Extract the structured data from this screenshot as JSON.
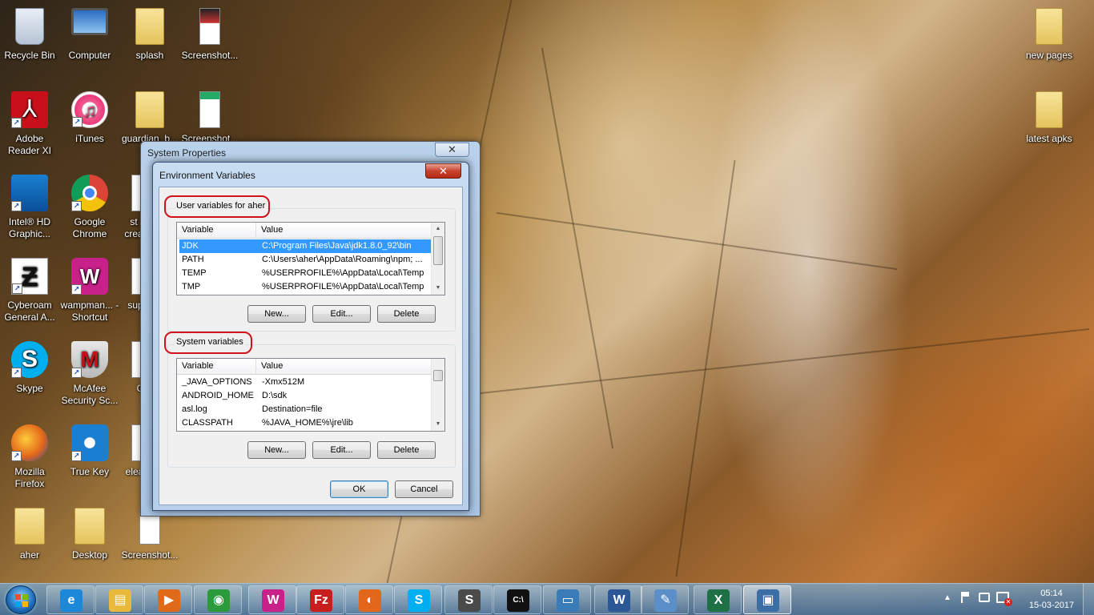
{
  "desktop": {
    "icons": [
      {
        "label": "Recycle Bin",
        "icon": "recycle-bin-icon"
      },
      {
        "label": "Computer",
        "icon": "computer-icon"
      },
      {
        "label": "splash",
        "icon": "folder-icon"
      },
      {
        "label": "Screenshot...",
        "icon": "image-file-icon"
      },
      {
        "label": "Adobe Reader XI",
        "icon": "adobe-reader-icon"
      },
      {
        "label": "iTunes",
        "icon": "itunes-icon"
      },
      {
        "label": "guardian_b...",
        "icon": "folder-icon"
      },
      {
        "label": "Screenshot...",
        "icon": "image-file-icon"
      },
      {
        "label": "Intel® HD Graphic...",
        "icon": "intel-graphics-icon"
      },
      {
        "label": "Google Chrome",
        "icon": "chrome-icon"
      },
      {
        "label": "st crea",
        "icon": "file-icon"
      },
      {
        "label": "Cyberoam General A...",
        "icon": "cyberoam-icon"
      },
      {
        "label": "wampman... - Shortcut",
        "icon": "wamp-icon"
      },
      {
        "label": "sup",
        "icon": "file-icon"
      },
      {
        "label": "Skype",
        "icon": "skype-icon"
      },
      {
        "label": "McAfee Security Sc...",
        "icon": "mcafee-icon"
      },
      {
        "label": "C",
        "icon": "file-icon"
      },
      {
        "label": "Mozilla Firefox",
        "icon": "firefox-icon"
      },
      {
        "label": "True Key",
        "icon": "truekey-icon"
      },
      {
        "label": "elea",
        "icon": "file-icon"
      },
      {
        "label": "aher",
        "icon": "user-folder-icon"
      },
      {
        "label": "Desktop",
        "icon": "folder-icon"
      },
      {
        "label": "Screenshot...",
        "icon": "image-file-icon"
      },
      {
        "label": "new pages",
        "icon": "folder-icon"
      },
      {
        "label": "latest apks",
        "icon": "folder-icon"
      }
    ]
  },
  "system_properties": {
    "title": "System Properties",
    "close": "✕"
  },
  "env_dialog": {
    "title": "Environment Variables",
    "close": "✕",
    "user_group_label": "User variables for aher",
    "system_group_label": "System variables",
    "col_variable": "Variable",
    "col_value": "Value",
    "user_vars": [
      {
        "name": "JDK",
        "value": "C:\\Program Files\\Java\\jdk1.8.0_92\\bin",
        "selected": true
      },
      {
        "name": "PATH",
        "value": "C:\\Users\\aher\\AppData\\Roaming\\npm; ...",
        "selected": false
      },
      {
        "name": "TEMP",
        "value": "%USERPROFILE%\\AppData\\Local\\Temp",
        "selected": false
      },
      {
        "name": "TMP",
        "value": "%USERPROFILE%\\AppData\\Local\\Temp",
        "selected": false
      }
    ],
    "system_vars": [
      {
        "name": "_JAVA_OPTIONS",
        "value": "-Xmx512M"
      },
      {
        "name": "ANDROID_HOME",
        "value": "D:\\sdk"
      },
      {
        "name": "asl.log",
        "value": "Destination=file"
      },
      {
        "name": "CLASSPATH",
        "value": "%JAVA_HOME%\\jre\\lib"
      }
    ],
    "new_label": "New...",
    "edit_label": "Edit...",
    "delete_label": "Delete",
    "ok_label": "OK",
    "cancel_label": "Cancel"
  },
  "taskbar": {
    "apps": [
      {
        "name": "internet-explorer-icon",
        "glyph": "e",
        "color": "#1e88d8"
      },
      {
        "name": "file-explorer-icon",
        "glyph": "▤",
        "color": "#e8b93a"
      },
      {
        "name": "media-player-icon",
        "glyph": "▶",
        "color": "#e06a1a"
      },
      {
        "name": "chrome-icon",
        "glyph": "◉",
        "color": "#2a9a3a"
      },
      {
        "name": "wamp-icon",
        "glyph": "W",
        "color": "#c8218a"
      },
      {
        "name": "filezilla-icon",
        "glyph": "Fz",
        "color": "#c81e1e"
      },
      {
        "name": "firefox-icon",
        "glyph": "◐",
        "color": "#e3671a"
      },
      {
        "name": "skype-icon",
        "glyph": "S",
        "color": "#00aff0"
      },
      {
        "name": "sublime-text-icon",
        "glyph": "S",
        "color": "#4a4a4a"
      },
      {
        "name": "command-prompt-icon",
        "glyph": "C:\\",
        "color": "#111111"
      },
      {
        "name": "photo-viewer-icon",
        "glyph": "▭",
        "color": "#3a7cb8"
      },
      {
        "name": "word-icon",
        "glyph": "W",
        "color": "#2b5797"
      },
      {
        "name": "paint-icon",
        "glyph": "✎",
        "color": "#5a8fc8"
      },
      {
        "name": "excel-icon",
        "glyph": "X",
        "color": "#1e7145"
      },
      {
        "name": "system-properties-icon",
        "glyph": "▣",
        "color": "#3a6ea5"
      }
    ],
    "time": "05:14",
    "date": "15-03-2017"
  }
}
